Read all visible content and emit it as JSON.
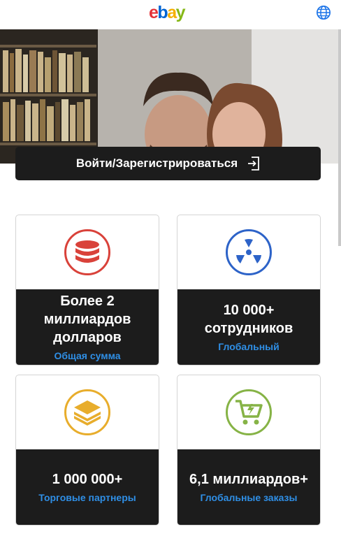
{
  "header": {
    "logo": {
      "e": "e",
      "b": "b",
      "a": "a",
      "y": "y"
    },
    "logo_colors": {
      "e": "#e53238",
      "b": "#0064d2",
      "a": "#f5af02",
      "y": "#86b817"
    },
    "language_icon": "globe-icon"
  },
  "login": {
    "label": "Войти/Зарегистрироваться",
    "icon": "sign-in-icon"
  },
  "stats": [
    {
      "value": "Более 2 миллиардов долларов",
      "caption": "Общая сумма",
      "icon": "coins-stack-icon",
      "color": "#d9423a"
    },
    {
      "value": "10 000+ сотрудников",
      "caption": "Глобальный",
      "icon": "radiation-icon",
      "color": "#2d63c8"
    },
    {
      "value": "1 000 000+",
      "caption": "Торговые партнеры",
      "icon": "layers-icon",
      "color": "#e8ad2c"
    },
    {
      "value": "6,1 миллиардов+",
      "caption": "Глобальные заказы",
      "icon": "cart-flash-icon",
      "color": "#86b346"
    }
  ],
  "colors": {
    "card_dark": "#1c1c1c",
    "caption_blue": "#2f8fe6"
  }
}
